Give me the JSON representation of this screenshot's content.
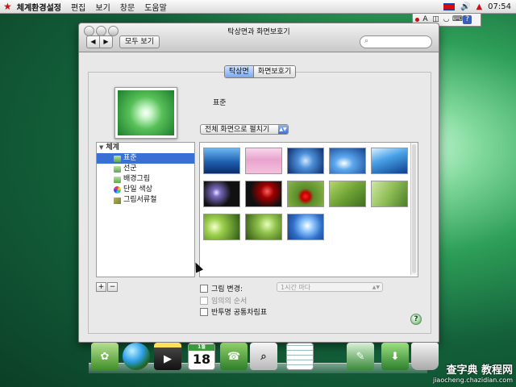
{
  "menubar": {
    "app_name": "체계환경설정",
    "items": [
      "편집",
      "보기",
      "창문",
      "도움말"
    ],
    "clock": "07:54"
  },
  "window": {
    "title": "탁상면과 화면보호기",
    "show_all": "모두 보기",
    "search_placeholder": "",
    "tabs": [
      "탁상면",
      "화면보호기"
    ],
    "current_name": "표준",
    "fill_mode": "전체 화면으로 펼치기",
    "source_list": {
      "group": "체계",
      "items": [
        "표준",
        "선군",
        "배경그림",
        "단일 색상",
        "그림서류철"
      ]
    },
    "options": {
      "change_picture": "그림 변경:",
      "interval": "1시간 마다",
      "random_order": "임의의 순서",
      "translucent_menubar": "반투명 공통차림표"
    }
  },
  "dock": {
    "calendar_month": "1월",
    "calendar_day": "18"
  },
  "watermark": {
    "main": "查字典 教程网",
    "url": "jiaocheng.chazidian.com"
  }
}
